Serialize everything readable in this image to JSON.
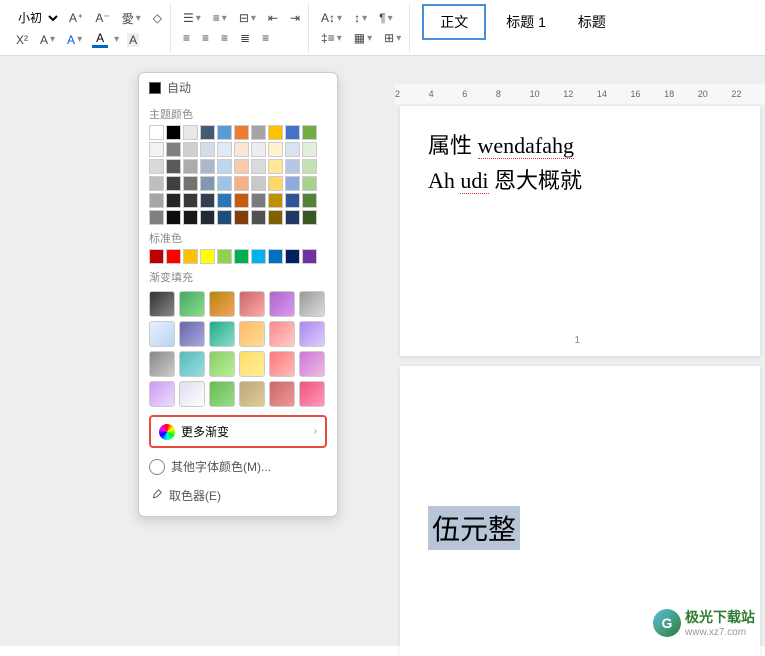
{
  "toolbar": {
    "font_size_label": "小初",
    "styles": {
      "body": "正文",
      "heading1": "标题 1",
      "heading": "标题"
    }
  },
  "color_panel": {
    "auto_label": "自动",
    "theme_colors_label": "主题颜色",
    "standard_colors_label": "标准色",
    "gradient_fill_label": "渐变填充",
    "more_gradients_label": "更多渐变",
    "other_colors_label": "其他字体颜色(M)...",
    "eyedropper_label": "取色器(E)",
    "theme_row1": [
      "#ffffff",
      "#000000",
      "#e8e8e8",
      "#445b77",
      "#5b9bd5",
      "#ed7d31",
      "#a5a5a5",
      "#ffc000",
      "#4472c4",
      "#70ad47"
    ],
    "theme_shades": [
      [
        "#f2f2f2",
        "#808080",
        "#d0cece",
        "#d6dce5",
        "#deebf7",
        "#fbe5d6",
        "#ededed",
        "#fff2cc",
        "#d9e2f3",
        "#e2efda"
      ],
      [
        "#d9d9d9",
        "#595959",
        "#aeabab",
        "#adb9ca",
        "#bdd7ee",
        "#f8cbad",
        "#dbdbdb",
        "#ffe699",
        "#b4c7e7",
        "#c5e0b4"
      ],
      [
        "#bfbfbf",
        "#404040",
        "#757171",
        "#8497b0",
        "#9dc3e6",
        "#f4b183",
        "#c9c9c9",
        "#ffd966",
        "#8faadc",
        "#a9d18e"
      ],
      [
        "#a6a6a6",
        "#262626",
        "#3b3838",
        "#333f50",
        "#2e75b6",
        "#c55a11",
        "#7b7b7b",
        "#bf9000",
        "#2f5597",
        "#548235"
      ],
      [
        "#808080",
        "#0d0d0d",
        "#171717",
        "#222a35",
        "#1f4e79",
        "#843c0c",
        "#525252",
        "#806000",
        "#203864",
        "#385723"
      ]
    ],
    "standard_colors": [
      "#c00000",
      "#ff0000",
      "#ffc000",
      "#ffff00",
      "#92d050",
      "#00b050",
      "#00b0f0",
      "#0070c0",
      "#002060",
      "#7030a0"
    ],
    "gradients": [
      "linear-gradient(135deg,#333,#888)",
      "linear-gradient(135deg,#4a6,#8d8)",
      "linear-gradient(135deg,#b8860b,#f4a460)",
      "linear-gradient(135deg,#c66,#faa)",
      "linear-gradient(135deg,#a6c,#d9e)",
      "linear-gradient(135deg,#999,#ddd)",
      "linear-gradient(135deg,#e8f0fe,#b8d4f0)",
      "linear-gradient(135deg,#66a,#aad)",
      "linear-gradient(135deg,#2a8,#8dc)",
      "linear-gradient(135deg,#fb6,#fd9)",
      "linear-gradient(135deg,#f88,#fcc)",
      "linear-gradient(135deg,#a8e,#dcf)",
      "linear-gradient(135deg,#888,#ccc)",
      "linear-gradient(135deg,#5bb,#9dd)",
      "linear-gradient(135deg,#8c6,#be9)",
      "linear-gradient(135deg,#fd6,#fe9)",
      "linear-gradient(135deg,#f77,#fbb)",
      "linear-gradient(135deg,#c7d,#ebd)",
      "linear-gradient(135deg,#c9e,#edf)",
      "linear-gradient(135deg,#dde,#fff)",
      "linear-gradient(135deg,#6b5,#9d8)",
      "linear-gradient(135deg,#ba7,#dc9)",
      "linear-gradient(135deg,#c66,#e99)",
      "linear-gradient(135deg,#e57,#f9b)"
    ]
  },
  "ruler": {
    "marks": [
      "2",
      "4",
      "6",
      "8",
      "10",
      "12",
      "14",
      "16",
      "18",
      "20",
      "22"
    ]
  },
  "document": {
    "page1": {
      "line1_part1": "属性 ",
      "line1_part2": "wendafahg",
      "line2_part1": "Ah ",
      "line2_part2": "udi",
      "line2_part3": " 恩大概就",
      "page_number": "1"
    },
    "page2": {
      "selected": "伍元整"
    }
  },
  "watermark": {
    "name": "极光下载站",
    "url": "www.xz7.com"
  }
}
